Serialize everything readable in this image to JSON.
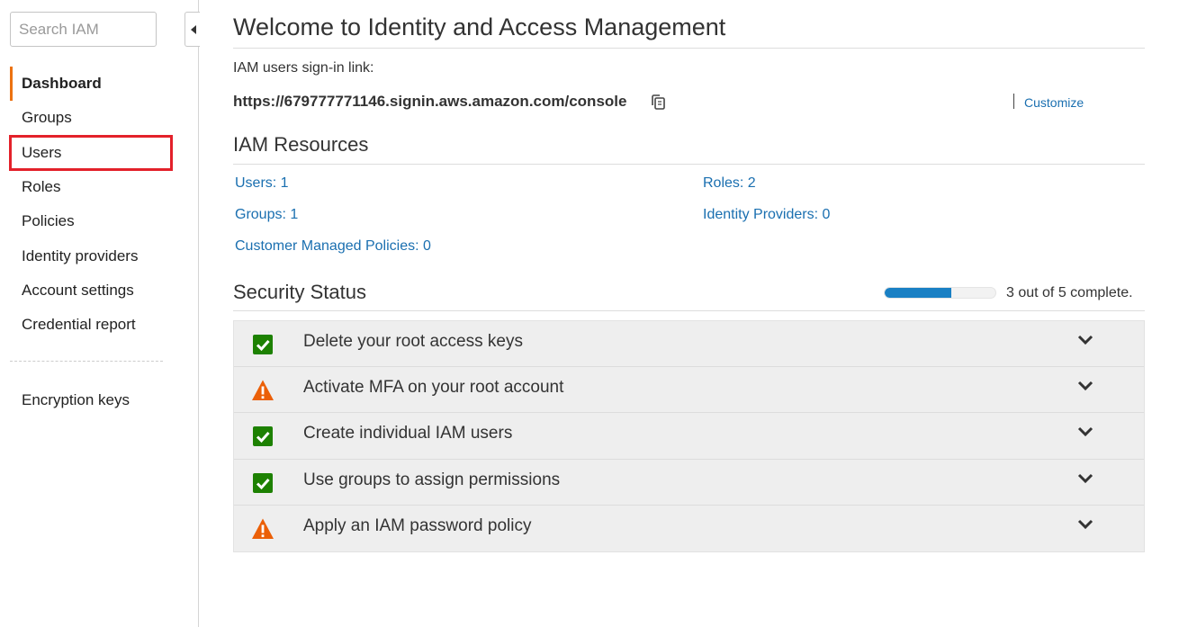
{
  "sidebar": {
    "search_placeholder": "Search IAM",
    "items": [
      {
        "label": "Dashboard"
      },
      {
        "label": "Groups"
      },
      {
        "label": "Users"
      },
      {
        "label": "Roles"
      },
      {
        "label": "Policies"
      },
      {
        "label": "Identity providers"
      },
      {
        "label": "Account settings"
      },
      {
        "label": "Credential report"
      }
    ],
    "items2": [
      {
        "label": "Encryption keys"
      }
    ]
  },
  "main": {
    "title": "Welcome to Identity and Access Management",
    "signin_label": "IAM users sign-in link:",
    "signin_url": "https://679777771146.signin.aws.amazon.com/console",
    "customize_label": "Customize",
    "resources_title": "IAM Resources",
    "resources": {
      "users": "Users: 1",
      "roles": "Roles: 2",
      "groups": "Groups: 1",
      "identity_providers": "Identity Providers: 0",
      "customer_policies": "Customer Managed Policies: 0"
    },
    "security_title": "Security Status",
    "progress_fraction": 0.6,
    "progress_text": "3 out of 5 complete.",
    "status_items": [
      {
        "label": "Delete your root access keys",
        "status": "complete",
        "icon": "check-icon"
      },
      {
        "label": "Activate MFA on your root account",
        "status": "warning",
        "icon": "warning-icon"
      },
      {
        "label": "Create individual IAM users",
        "status": "complete",
        "icon": "check-icon"
      },
      {
        "label": "Use groups to assign permissions",
        "status": "complete",
        "icon": "check-icon"
      },
      {
        "label": "Apply an IAM password policy",
        "status": "warning",
        "icon": "warning-icon"
      }
    ]
  },
  "colors": {
    "accent": "#ec7211",
    "link": "#1a6fb0",
    "highlight_box": "#e3212a",
    "success": "#1d8102",
    "warning": "#eb5f07",
    "progress": "#1a80c4"
  }
}
